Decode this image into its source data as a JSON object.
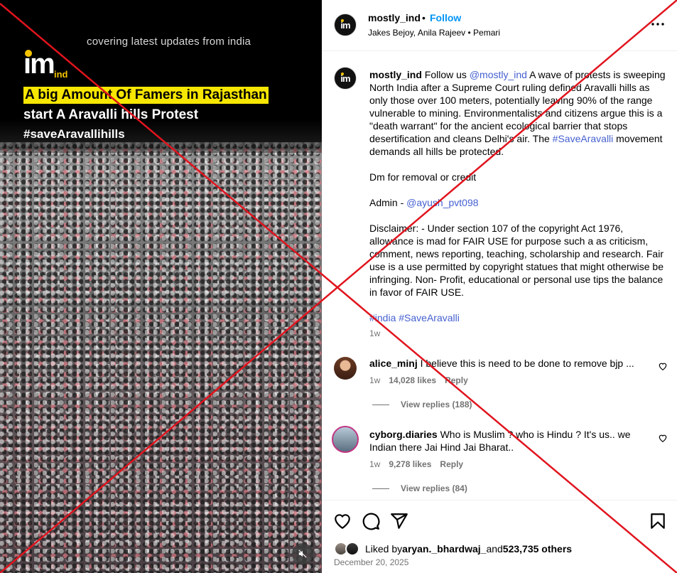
{
  "media": {
    "tagline": "covering latest updates from india",
    "logo_text": "im",
    "logo_suffix": "ind",
    "headline_1": "A big Amount Of Famers in Rajasthan",
    "headline_2": "start A Aravalli hills Protest",
    "headline_3": "#saveAravallihills",
    "mute_icon": "speaker-muted-icon"
  },
  "header": {
    "username": "mostly_ind",
    "separator": "•",
    "follow_label": "Follow",
    "subline": "Jakes Bejoy, Anila Rajeev • Pemari",
    "more_icon": "more-horizontal-icon"
  },
  "caption": {
    "username": "mostly_ind",
    "p1_pre": " Follow us ",
    "p1_mention": "@mostly_ind",
    "p1_mid": " A wave of protests is sweeping North India after a Supreme Court ruling defined Aravalli hills as only those over 100 meters, potentially leaving 90% of the range vulnerable to mining. Environmentalists and citizens argue this is a \"death warrant\" for the ancient ecological barrier that stops desertification and cleans Delhi's air. The ",
    "p1_hashtag": "#SaveAravalli",
    "p1_post": " movement demands all hills be protected.",
    "p2": "Dm for removal or credit",
    "p3_pre": "Admin - ",
    "p3_mention": "@ayush_pvt098",
    "p4": "Disclaimer: - Under section 107 of the copyright Act 1976, allowance is mad for FAIR USE for purpose such a as criticism, comment, news reporting, teaching, scholarship and research. Fair use is a use permitted by copyright statues that might otherwise be infringing. Non- Profit, educational or personal use tips the balance in favor of FAIR USE.",
    "hashtag_1": "#india",
    "hashtag_2": "#SaveAravalli",
    "time": "1w"
  },
  "comments": [
    {
      "username": "alice_minj",
      "text": " I believe this is need to be done to remove bjp ...",
      "time": "1w",
      "likes": "14,028 likes",
      "reply": "Reply",
      "view_replies": "View replies (188)"
    },
    {
      "username": "cyborg.diaries",
      "text": " Who is Muslim ? who is Hindu ? It's us.. we Indian there Jai Hind Jai Bharat..",
      "time": "1w",
      "likes": "9,278 likes",
      "reply": "Reply",
      "view_replies": "View replies (84)"
    }
  ],
  "actions": {
    "icons": [
      "heart-icon",
      "comment-icon",
      "share-icon",
      "bookmark-icon"
    ],
    "liked_prefix": "Liked by ",
    "liked_user": "aryan._bhardwaj_",
    "liked_mid": " and ",
    "liked_count": "523,735 others",
    "date": "December 20, 2025"
  },
  "colors": {
    "link_blue": "#0095f6",
    "mention_blue": "#4561d0",
    "highlight_yellow": "#f7e600",
    "overlay_red": "#e0141e"
  }
}
